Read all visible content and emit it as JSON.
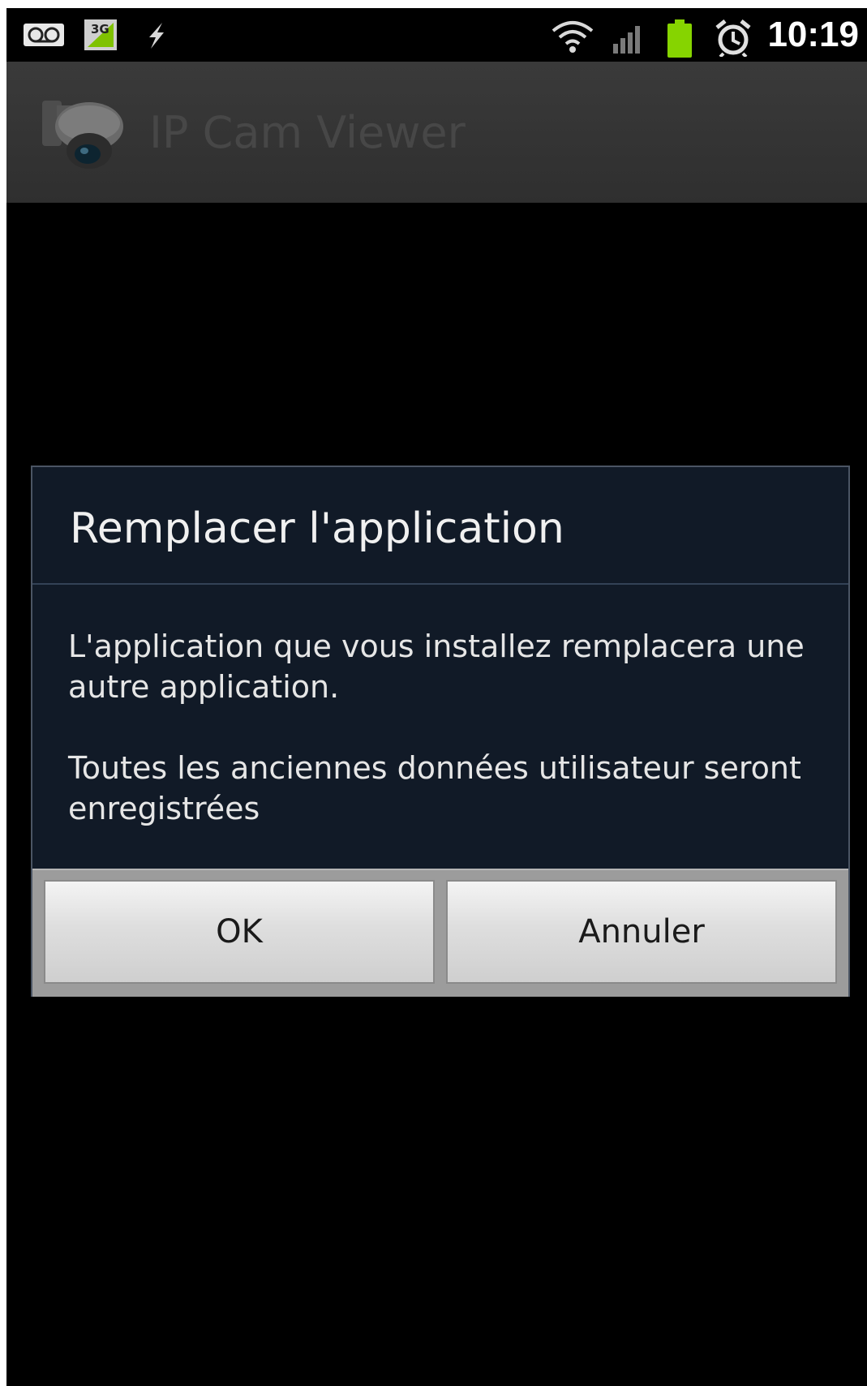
{
  "status_bar": {
    "time": "10:19",
    "network_label": "3G",
    "icons": [
      "voicemail-icon",
      "3g-data-icon",
      "usb-icon",
      "wifi-icon",
      "signal-icon",
      "battery-icon",
      "alarm-icon"
    ],
    "battery_color": "#86d400"
  },
  "action_bar": {
    "app_title": "IP Cam Viewer",
    "logo_icon": "camera-dome-icon"
  },
  "dialog": {
    "title": "Remplacer l'application",
    "message_paragraphs": [
      "L'application que vous installez remplacera une autre application.",
      "Toutes les anciennes données utilisateur seront enregistrées"
    ],
    "buttons": {
      "ok": "OK",
      "cancel": "Annuler"
    }
  }
}
